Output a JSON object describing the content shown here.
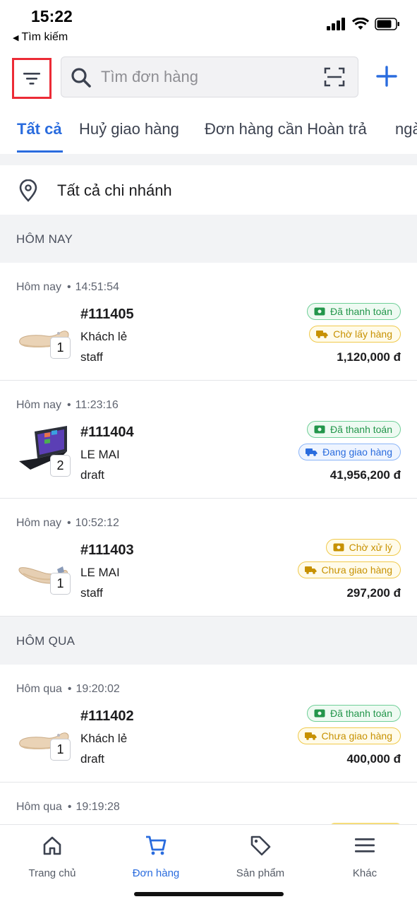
{
  "status_bar": {
    "time": "15:22",
    "back_label": "Tìm kiếm"
  },
  "search": {
    "placeholder": "Tìm đơn hàng"
  },
  "tabs": [
    {
      "label": "Tất cả",
      "active": true
    },
    {
      "label": "Huỷ giao hàng",
      "active": false
    },
    {
      "label": "Đơn hàng cần Hoàn trả",
      "active": false
    },
    {
      "label": "ngà",
      "active": false
    }
  ],
  "branch": {
    "label": "Tất cả chi nhánh"
  },
  "sections": [
    {
      "title": "HÔM NAY"
    },
    {
      "title": "HÔM QUA"
    }
  ],
  "orders": [
    {
      "day": "Hôm nay",
      "time": "14:51:54",
      "id": "#111405",
      "customer": "Khách lẻ",
      "source": "staff",
      "qty": "1",
      "product": "shoe-icon",
      "payment": "Đã thanh toán",
      "payment_icon": "cash-icon",
      "shipping": "Chờ lấy hàng",
      "shipping_style": "wait",
      "total": "1,120,000 đ"
    },
    {
      "day": "Hôm nay",
      "time": "11:23:16",
      "id": "#111404",
      "customer": "LE MAI",
      "source": "draft",
      "qty": "2",
      "product": "laptop-icon",
      "payment": "Đã thanh toán",
      "payment_icon": "cash-icon",
      "shipping": "Đang giao hàng",
      "shipping_style": "ship",
      "total": "41,956,200 đ"
    },
    {
      "day": "Hôm nay",
      "time": "10:52:12",
      "id": "#111403",
      "customer": "LE MAI",
      "source": "staff",
      "qty": "1",
      "product": "shoe-icon",
      "payment": "Chờ xử lý",
      "payment_icon": "cash-icon",
      "shipping": "Chưa giao hàng",
      "shipping_style": "wait",
      "total": "297,200 đ"
    },
    {
      "day": "Hôm qua",
      "time": "19:20:02",
      "id": "#111402",
      "customer": "Khách lẻ",
      "source": "draft",
      "qty": "1",
      "product": "shoe-icon",
      "payment": "Đã thanh toán",
      "payment_icon": "cash-icon",
      "shipping": "Chưa giao hàng",
      "shipping_style": "wait",
      "total": "400,000 đ"
    },
    {
      "day": "Hôm qua",
      "time": "19:19:28"
    }
  ],
  "bottom_nav": [
    {
      "label": "Trang chủ",
      "icon": "home-icon",
      "active": false
    },
    {
      "label": "Đơn hàng",
      "icon": "cart-icon",
      "active": true
    },
    {
      "label": "Sản phẩm",
      "icon": "tag-icon",
      "active": false
    },
    {
      "label": "Khác",
      "icon": "menu-icon",
      "active": false
    }
  ],
  "colors": {
    "accent": "#2a6cde",
    "highlight_border": "#ec2b36",
    "paid_green": "#23964b",
    "pending_yellow": "#c79100"
  }
}
